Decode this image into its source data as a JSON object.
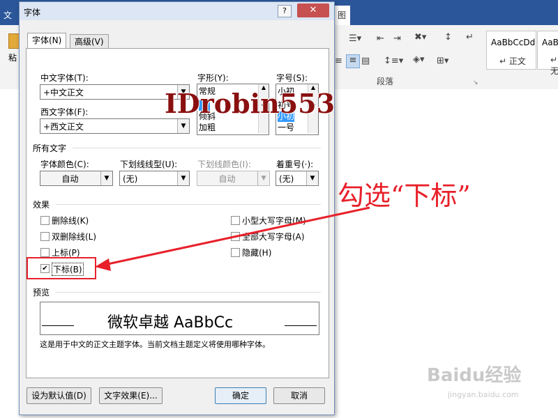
{
  "app": {
    "menu_left": "文",
    "menu_pic": "图",
    "style_boxes": [
      {
        "preview": "AaBbCcDd",
        "name": "↵ 正文"
      },
      {
        "preview": "AaBb",
        "name": "↵ 无"
      }
    ],
    "ribbon_group_label": "段落",
    "bg_left_char": "粘"
  },
  "dialog": {
    "title": "字体",
    "help": "?",
    "close": "✕",
    "tabs": [
      {
        "label": "字体(N)",
        "active": true
      },
      {
        "label": "高级(V)",
        "active": false
      }
    ],
    "chinese_font_label": "中文字体(T):",
    "chinese_font_value": "+中文正文",
    "western_font_label": "西文字体(F):",
    "western_font_value": "+西文正文",
    "style_label": "字形(Y):",
    "style_value": "常规",
    "style_options": [
      "常规",
      "倾斜",
      "加粗"
    ],
    "size_label": "字号(S):",
    "size_value": "小初",
    "size_options": [
      "初号",
      "小初",
      "一号"
    ],
    "all_text_header": "所有文字",
    "font_color_label": "字体颜色(C):",
    "font_color_value": "自动",
    "underline_type_label": "下划线线型(U):",
    "underline_type_value": "(无)",
    "underline_color_label": "下划线颜色(I):",
    "underline_color_value": "自动",
    "emphasis_label": "着重号(·):",
    "emphasis_value": "(无)",
    "effects_header": "效果",
    "effects_left": [
      {
        "label": "删除线(K)",
        "checked": false
      },
      {
        "label": "双删除线(L)",
        "checked": false
      },
      {
        "label": "上标(P)",
        "checked": false
      },
      {
        "label": "下标(B)",
        "checked": true
      }
    ],
    "effects_right": [
      {
        "label": "小型大写字母(M)",
        "checked": false
      },
      {
        "label": "全部大写字母(A)",
        "checked": false
      },
      {
        "label": "隐藏(H)",
        "checked": false
      }
    ],
    "preview_header": "预览",
    "preview_text": "微软卓越  AaBbCc",
    "preview_note": "这是用于中文的正文主题字体。当前文档主题定义将使用哪种字体。",
    "set_default_button": "设为默认值(D)",
    "text_effects_button": "文字效果(E)...",
    "ok_button": "确定",
    "cancel_button": "取消"
  },
  "annotation": {
    "text": "勾选“下标”",
    "color": "#e8202a"
  },
  "watermark": {
    "text": "IDrobin553",
    "baidu_logo": "Baidu经验",
    "baidu_url": "jingyan.baidu.com"
  }
}
